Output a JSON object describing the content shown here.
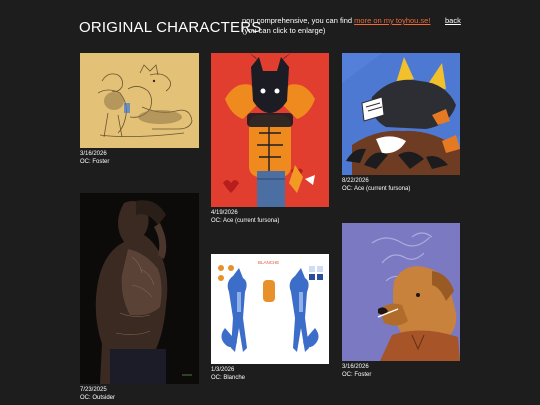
{
  "header": {
    "title": "ORIGINAL CHARACTERS",
    "intro_prefix": "non comprehensive, you can find ",
    "intro_link": "more on my toyhou.se!",
    "intro_suffix": "(you can click to enlarge)",
    "back_label": "back"
  },
  "colors": {
    "background": "#1d1d1d",
    "text": "#ffffff",
    "link": "#f0693a"
  },
  "gallery": [
    {
      "date": "3/16/2026",
      "oc": "OC: Foster"
    },
    {
      "date": "4/19/2026",
      "oc": "OC: Ace (current fursona)"
    },
    {
      "date": "8/22/2026",
      "oc": "OC: Ace (current fursona)"
    },
    {
      "date": "7/23/2025",
      "oc": "OC: Outsider"
    },
    {
      "date": "1/3/2026",
      "oc": "OC: Blanche"
    },
    {
      "date": "3/16/2026",
      "oc": "OC: Foster"
    }
  ],
  "ref_sheet": {
    "name_label": "BLANCHE"
  }
}
